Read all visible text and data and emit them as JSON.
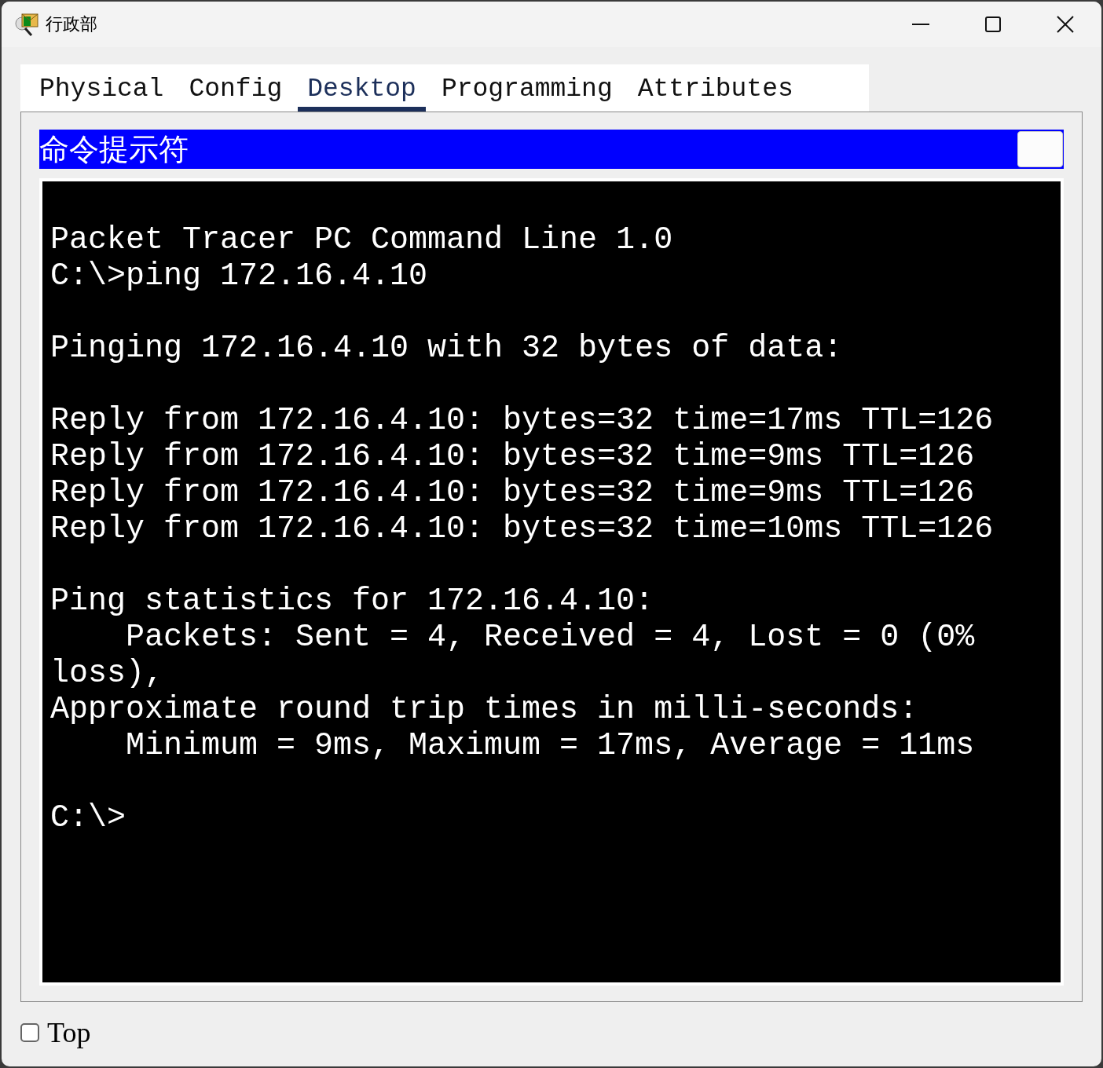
{
  "window": {
    "title": "行政部"
  },
  "tabs": [
    {
      "label": "Physical",
      "selected": false
    },
    {
      "label": "Config",
      "selected": false
    },
    {
      "label": "Desktop",
      "selected": true
    },
    {
      "label": "Programming",
      "selected": false
    },
    {
      "label": "Attributes",
      "selected": false
    }
  ],
  "app": {
    "title": "命令提示符"
  },
  "terminal": {
    "blocks": [
      [
        "Packet Tracer PC Command Line 1.0",
        "C:\\>ping 172.16.4.10"
      ],
      [
        "Pinging 172.16.4.10 with 32 bytes of data:"
      ],
      [
        "Reply from 172.16.4.10: bytes=32 time=17ms TTL=126",
        "Reply from 172.16.4.10: bytes=32 time=9ms TTL=126",
        "Reply from 172.16.4.10: bytes=32 time=9ms TTL=126",
        "Reply from 172.16.4.10: bytes=32 time=10ms TTL=126"
      ],
      [
        "Ping statistics for 172.16.4.10:",
        "    Packets: Sent = 4, Received = 4, Lost = 0 (0%",
        "loss),",
        "Approximate round trip times in milli-seconds:",
        "    Minimum = 9ms, Maximum = 17ms, Average = 11ms"
      ],
      [
        "C:\\>"
      ]
    ]
  },
  "top_checkbox": {
    "label": "Top",
    "checked": false
  }
}
